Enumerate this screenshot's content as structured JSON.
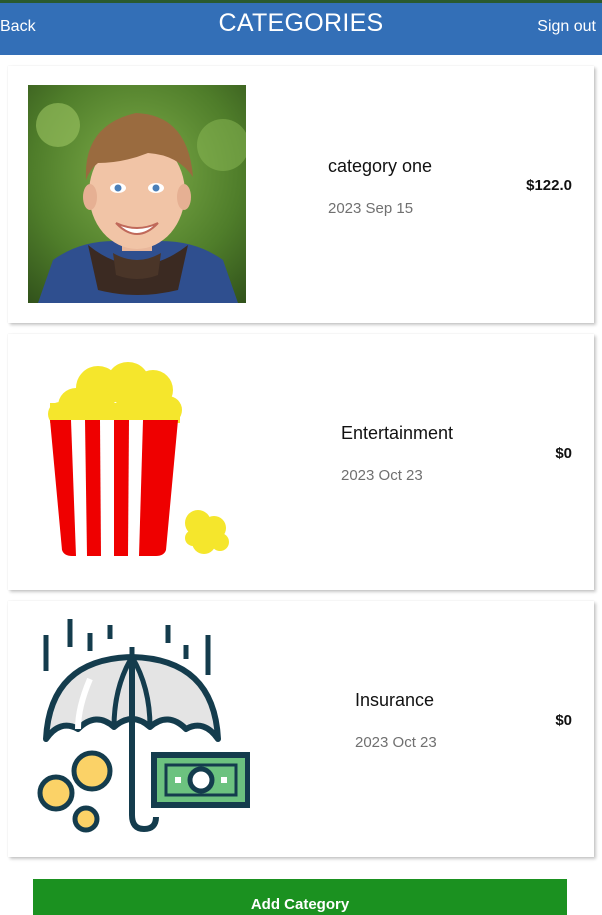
{
  "header": {
    "back_label": "Back",
    "title": "CATEGORIES",
    "signout_label": "Sign out",
    "bar_color": "#336fb7"
  },
  "categories": [
    {
      "name": "category one",
      "date": "2023 Sep 15",
      "amount": "$122.0",
      "icon": "child-photo"
    },
    {
      "name": "Entertainment",
      "date": "2023 Oct 23",
      "amount": "$0",
      "icon": "popcorn-icon"
    },
    {
      "name": "Insurance",
      "date": "2023 Oct 23",
      "amount": "$0",
      "icon": "umbrella-money-icon"
    }
  ],
  "add_button": {
    "label": "Add Category",
    "color": "#1b9120"
  }
}
